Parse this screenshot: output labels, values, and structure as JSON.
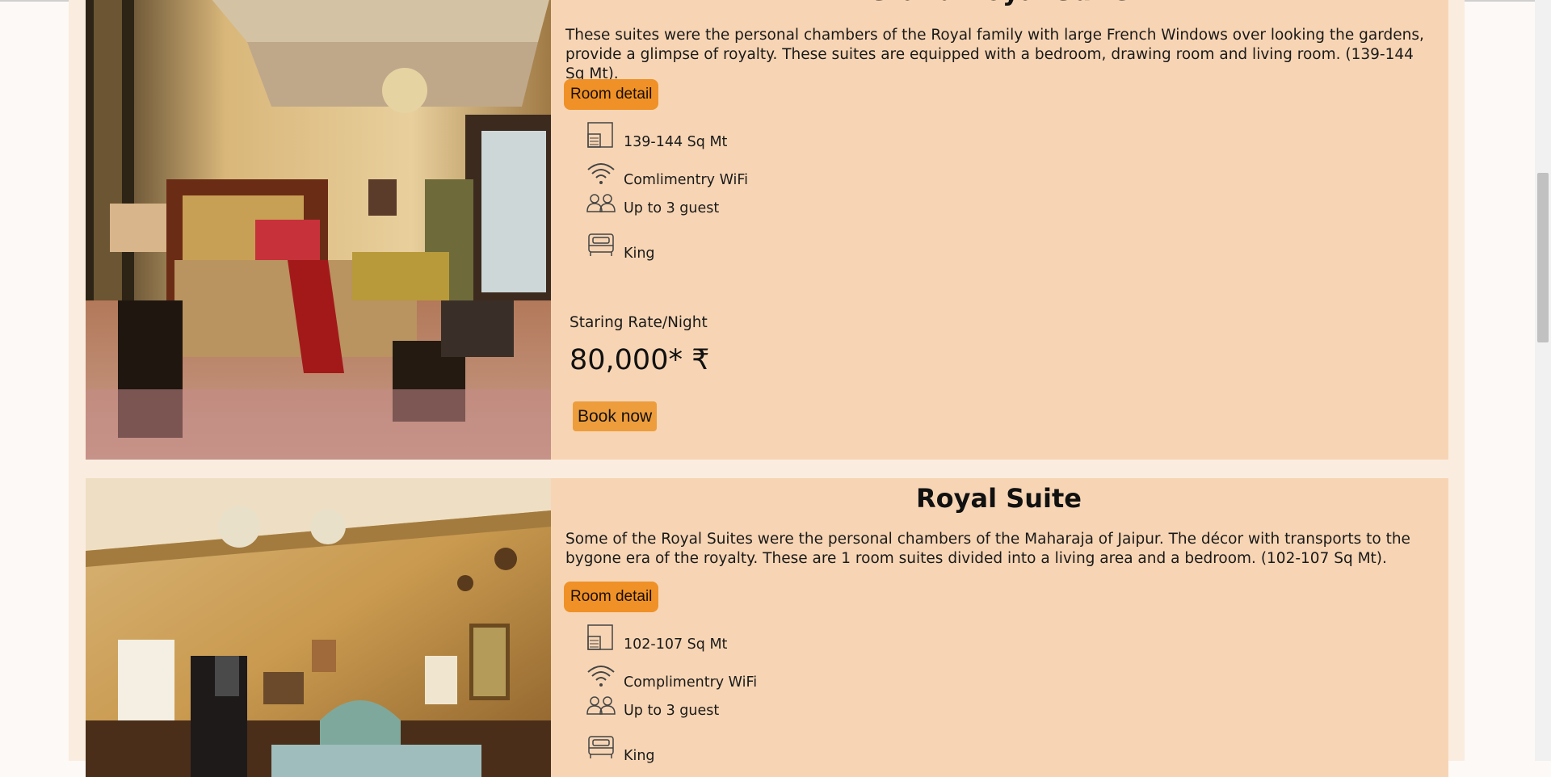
{
  "rooms": [
    {
      "title": "Grand Royal Suite",
      "description": "These suites were the personal chambers of the Royal family with large French Windows over looking the gardens, provide a glimpse of royalty. These suites are equipped with a bedroom, drawing room and living room. (139-144 Sq Mt).",
      "detail_label": "Room detail",
      "features": [
        {
          "icon": "room-area-icon",
          "label": "139-144 Sq Mt"
        },
        {
          "icon": "wifi-icon",
          "label": "Comlimentry WiFi"
        },
        {
          "icon": "guests-icon",
          "label": "Up to 3 guest"
        },
        {
          "icon": "bed-icon",
          "label": "King"
        }
      ],
      "rate_label": "Staring Rate/Night",
      "rate_value": "80,000* ₹",
      "book_label": "Book now"
    },
    {
      "title": "Royal Suite",
      "description": "Some of the Royal Suites were the personal chambers of the Maharaja of Jaipur. The décor with transports to the bygone era of the royalty. These are 1 room suites divided into a living area and a bedroom. (102-107 Sq Mt).",
      "detail_label": "Room detail",
      "features": [
        {
          "icon": "room-area-icon",
          "label": "102-107 Sq Mt"
        },
        {
          "icon": "wifi-icon",
          "label": "Complimentry WiFi"
        },
        {
          "icon": "guests-icon",
          "label": "Up to 3 guest"
        },
        {
          "icon": "bed-icon",
          "label": "King"
        }
      ]
    }
  ],
  "colors": {
    "card_bg": "#f7d5b4",
    "page_bg": "#fbece0",
    "button_orange": "#ef9127"
  }
}
